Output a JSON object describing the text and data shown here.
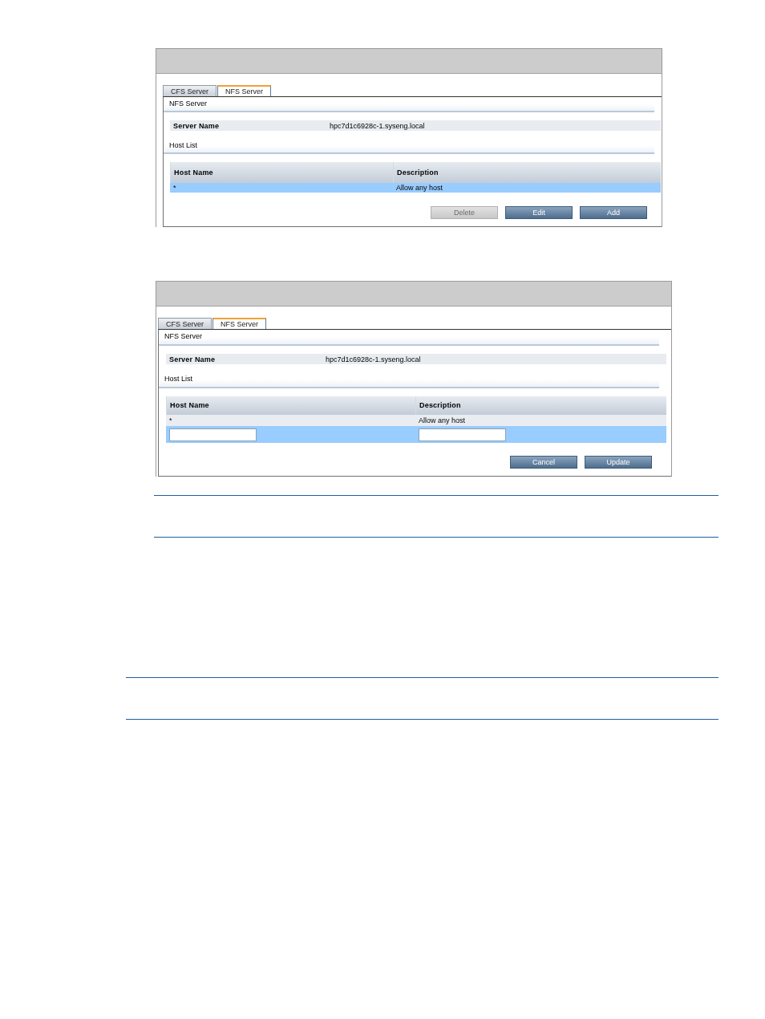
{
  "screenshots": [
    {
      "tabs": [
        {
          "label": "CFS Server",
          "selected": false
        },
        {
          "label": "NFS Server",
          "selected": true
        }
      ],
      "section_title": "NFS Server",
      "server_name": {
        "label": "Server Name",
        "value": "hpc7d1c6928c-1.syseng.local"
      },
      "host_list_title": "Host List",
      "table": {
        "columns": [
          "Host Name",
          "Description"
        ],
        "rows": [
          {
            "kind": "data",
            "cells": [
              "*",
              "Allow any host"
            ],
            "selected": true
          }
        ]
      },
      "buttons": [
        {
          "label": "Delete",
          "disabled": true
        },
        {
          "label": "Edit",
          "disabled": false
        },
        {
          "label": "Add",
          "disabled": false
        }
      ]
    },
    {
      "tabs": [
        {
          "label": "CFS Server",
          "selected": false
        },
        {
          "label": "NFS Server",
          "selected": true
        }
      ],
      "section_title": "NFS Server",
      "server_name": {
        "label": "Server Name",
        "value": "hpc7d1c6928c-1.syseng.local"
      },
      "host_list_title": "Host List",
      "table": {
        "columns": [
          "Host Name",
          "Description"
        ],
        "rows": [
          {
            "kind": "data",
            "cells": [
              "*",
              "Allow any host"
            ],
            "selected": false
          },
          {
            "kind": "input",
            "selected": true
          }
        ]
      },
      "buttons": [
        {
          "label": "Cancel",
          "disabled": false
        },
        {
          "label": "Update",
          "disabled": false
        }
      ]
    }
  ]
}
